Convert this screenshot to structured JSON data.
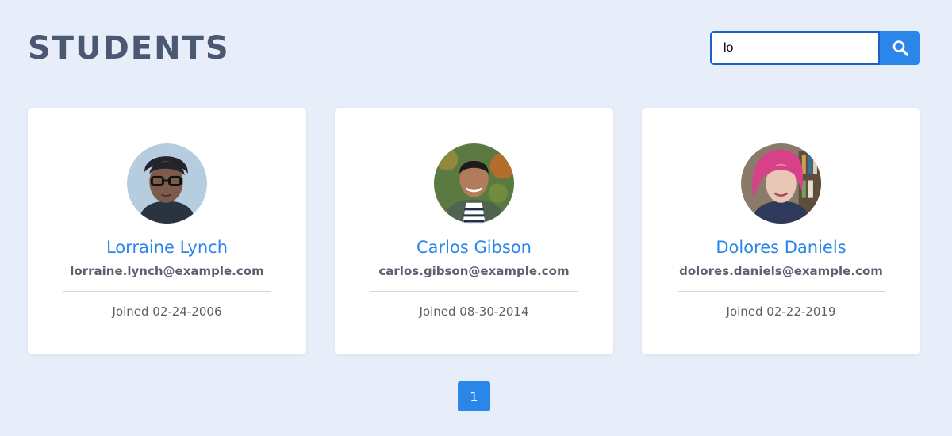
{
  "header": {
    "title": "STUDENTS"
  },
  "search": {
    "value": "lo"
  },
  "students": [
    {
      "name": "Lorraine Lynch",
      "email": "lorraine.lynch@example.com",
      "joined": "Joined 02-24-2006"
    },
    {
      "name": "Carlos Gibson",
      "email": "carlos.gibson@example.com",
      "joined": "Joined 08-30-2014"
    },
    {
      "name": "Dolores Daniels",
      "email": "dolores.daniels@example.com",
      "joined": "Joined 02-22-2019"
    }
  ],
  "pagination": {
    "pages": [
      "1"
    ],
    "current": "1"
  },
  "icons": {
    "search_button": "search-icon",
    "avatars": "avatar-photo"
  },
  "colors": {
    "background": "#e8eef9",
    "title": "#4a5871",
    "accent": "#2b86ea",
    "search_border": "#1f60c4"
  }
}
